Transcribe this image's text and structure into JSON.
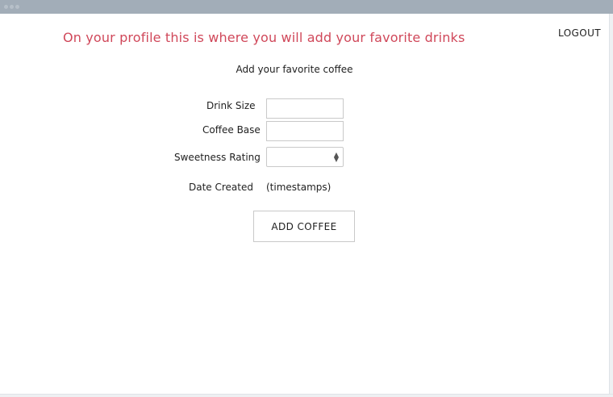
{
  "header": {
    "title": "On your profile this is where you will add your favorite drinks",
    "logout_label": "LOGOUT"
  },
  "form": {
    "heading": "Add your favorite coffee",
    "fields": {
      "drink_size_label": "Drink Size",
      "drink_size_value": "",
      "coffee_base_label": "Coffee Base",
      "coffee_base_value": "",
      "sweetness_label": "Sweetness Rating",
      "sweetness_value": "",
      "date_created_label": "Date Created",
      "date_created_value": "(timestamps)"
    },
    "submit_label": "ADD COFFEE"
  },
  "colors": {
    "accent": "#d0485a",
    "titlebar": "#a2adb8"
  },
  "icons": {
    "select_arrow": "sort-arrows-icon"
  }
}
